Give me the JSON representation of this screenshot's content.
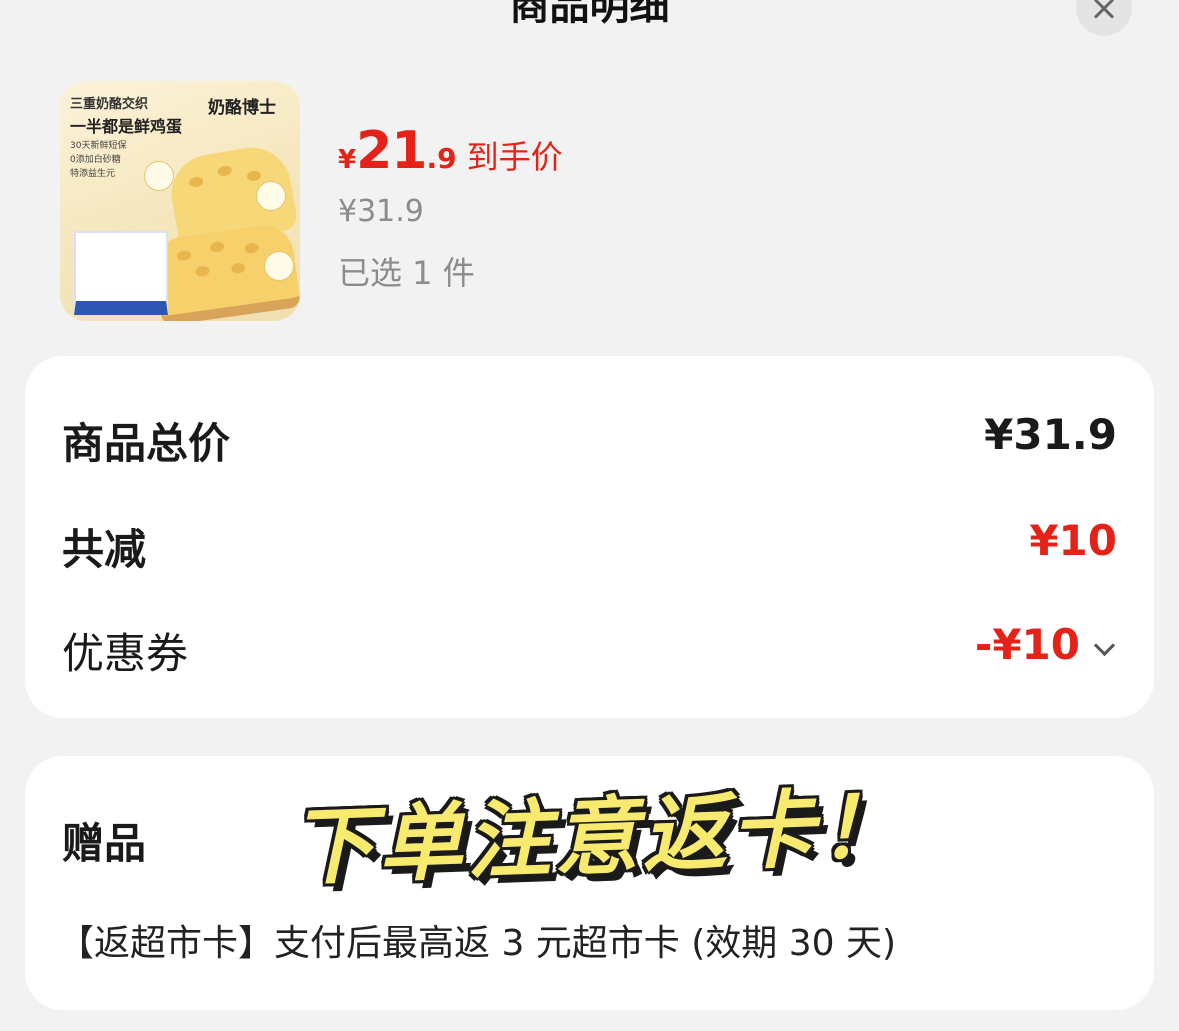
{
  "header": {
    "title": "商品明细",
    "close_icon": "close-icon"
  },
  "product": {
    "thumb": {
      "line1": "三重奶酪交织",
      "line2": "一半都是鲜鸡蛋",
      "brand": "奶酪博士",
      "bullets": [
        "30天新鲜短保",
        "0添加白砂糖",
        "特添益生元"
      ]
    },
    "price_currency": "¥",
    "price_int": "21",
    "price_dec": ".9",
    "price_label": "到手价",
    "original_price": "¥31.9",
    "selected_qty": "已选 1 件"
  },
  "summary": {
    "total_label": "商品总价",
    "total_value": "¥31.9",
    "discount_label": "共减",
    "discount_value": "¥10",
    "coupon_label": "优惠券",
    "coupon_value": "-¥10",
    "coupon_icon": "chevron-down-icon"
  },
  "gift": {
    "label": "赠品",
    "desc": "【返超市卡】支付后最高返 3 元超市卡 (效期 30 天)"
  },
  "overlay_text": "下单注意返卡！",
  "colors": {
    "accent_red": "#e52218",
    "overlay_yellow": "#f7ea6e"
  }
}
